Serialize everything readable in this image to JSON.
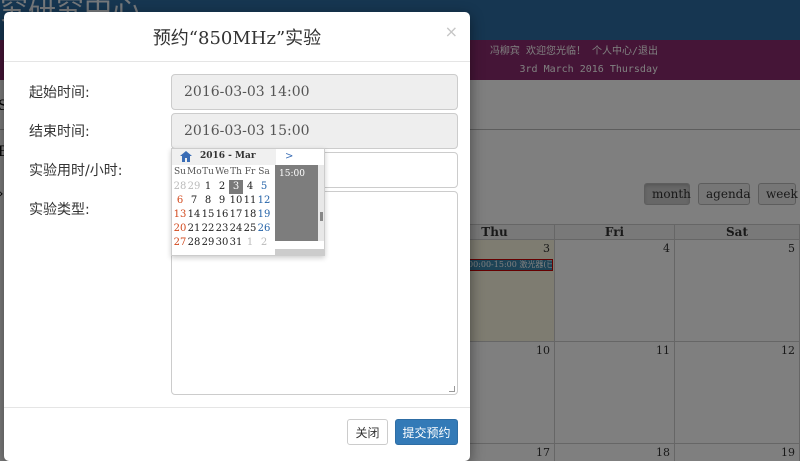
{
  "background": {
    "brand_fragment": "究研究中心",
    "userbar": {
      "line1": "冯柳宾 欢迎您光临！ 个人中心/退出",
      "line2": "3rd March 2016 Thursday"
    },
    "nav_fragment": "So",
    "side_fragment": "B",
    "calendar": {
      "views": [
        "month",
        "agenda",
        "week"
      ],
      "active_view": "month",
      "day_headers": [
        "Thu",
        "Fri",
        "Sat"
      ],
      "row1_days": [
        "3",
        "4",
        "5"
      ],
      "row2_days": [
        "10",
        "11",
        "12"
      ],
      "row3_days": [
        "17",
        "18",
        "19"
      ],
      "event_text": "00:00-15:00 激光器(已预约)"
    }
  },
  "modal": {
    "title": "预约“850MHz”实验",
    "close_glyph": "×",
    "fields": {
      "start_label": "起始时间:",
      "start_value": "2016-03-03 14:00",
      "end_label": "结束时间:",
      "end_value": "2016-03-03 15:00",
      "hours_label": "实验用时/小时:",
      "type_label": "实验类型:"
    },
    "buttons": {
      "close": "关闭",
      "submit": "提交预约"
    }
  },
  "picker": {
    "month_year": "2016 - Mar",
    "next_glyph": ">",
    "weekdays": [
      "Su",
      "Mo",
      "Tu",
      "We",
      "Th",
      "Fr",
      "Sa"
    ],
    "weeks": [
      [
        "28",
        "29",
        "1",
        "2",
        "3",
        "4",
        "5"
      ],
      [
        "6",
        "7",
        "8",
        "9",
        "10",
        "11",
        "12"
      ],
      [
        "13",
        "14",
        "15",
        "16",
        "17",
        "18",
        "19"
      ],
      [
        "20",
        "21",
        "22",
        "23",
        "24",
        "25",
        "26"
      ],
      [
        "27",
        "28",
        "29",
        "30",
        "31",
        "1",
        "2"
      ]
    ],
    "selected_day": "3",
    "time_slot": "15:00"
  },
  "colors": {
    "header_blue": "#2d6da3",
    "userbar_magenta": "#8a2a6e",
    "primary_button": "#337ab7",
    "sunday": "#d2491d",
    "saturday": "#2563a8"
  }
}
